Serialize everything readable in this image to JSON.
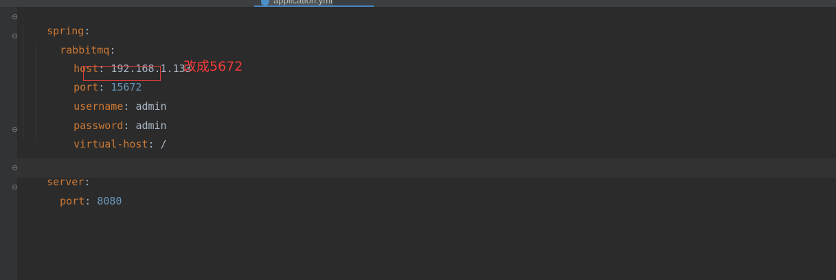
{
  "tabs": [
    {
      "label": "application.yml",
      "active": true
    }
  ],
  "code": {
    "spring_key": "spring",
    "rabbitmq_key": "rabbitmq",
    "host_key": "host",
    "host_val": "192.168.1.133",
    "port_key": "port",
    "port_val": "15672",
    "username_key": "username",
    "username_val": "admin",
    "password_key": "password",
    "password_val": "admin",
    "vhost_key": "virtual-host",
    "vhost_val": "/",
    "server_key": "server",
    "server_port_key": "port",
    "server_port_val": "8080"
  },
  "annotation": {
    "text": "改成5672",
    "color": "#f23a3a"
  }
}
